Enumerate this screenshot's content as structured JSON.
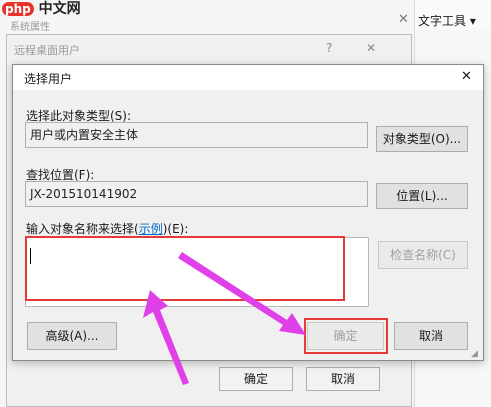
{
  "watermark": {
    "brand": "php",
    "site": "中文网"
  },
  "background_window": {
    "title": "系统属性",
    "toolbar_text": "文字工具",
    "buttons": {
      "ok": "确定",
      "cancel": "取消"
    }
  },
  "rdu_dialog": {
    "title": "远程桌面用户",
    "help": "?",
    "close": "✕"
  },
  "select_dialog": {
    "title": "选择用户",
    "close": "✕",
    "object_type_label": "选择此对象类型(S):",
    "object_type_value": "用户或内置安全主体",
    "object_type_button": "对象类型(O)...",
    "location_label": "查找位置(F):",
    "location_value": "JX-201510141902",
    "location_button": "位置(L)...",
    "names_label_prefix": "输入对象名称来选择(",
    "names_label_link": "示例",
    "names_label_suffix": ")(E):",
    "names_value": "",
    "check_names_button": "检查名称(C)",
    "advanced_button": "高级(A)...",
    "ok_button": "确定",
    "cancel_button": "取消"
  },
  "colors": {
    "highlight": "#e53a3a",
    "arrow": "#e040e8",
    "link": "#0066cc"
  }
}
